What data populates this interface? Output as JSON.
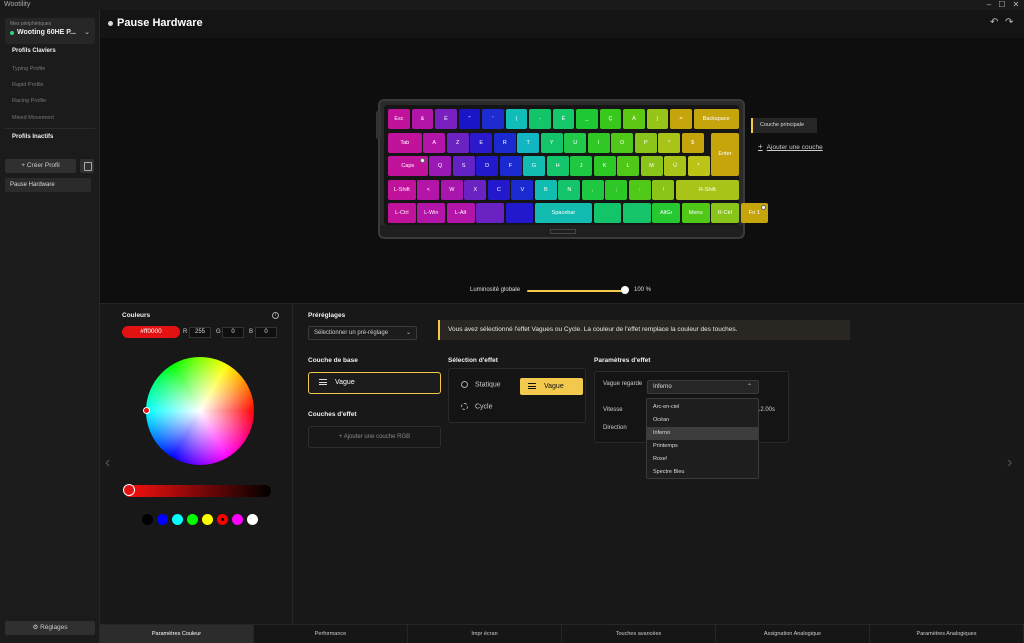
{
  "app": {
    "title": "Wootility"
  },
  "window_controls": {
    "minimize": "–",
    "maximize": "☐",
    "close": "✕"
  },
  "sidebar": {
    "device_label": "Mes périphériques",
    "device_name": "Wooting 60HE P...",
    "keyboard_profiles_heading": "Profils Claviers",
    "keyboard_profiles": [
      "Typing Profile",
      "Rapid Profile",
      "Racing Profile",
      "Mixed Movement"
    ],
    "inactive_profiles_heading": "Profils Inactifs",
    "create_profile": "Créer Profil",
    "inactive_profiles": [
      "Pause Hardware"
    ],
    "settings": "Réglages"
  },
  "header": {
    "title": "Pause Hardware",
    "undo_icon": "↶",
    "redo_icon": "↷"
  },
  "keyboard": {
    "rows": [
      [
        {
          "label": "Esc",
          "color": "#c0129a"
        },
        {
          "label": "&",
          "color": "#b315a8"
        },
        {
          "label": "É",
          "color": "#7a1fc0"
        },
        {
          "label": "\"",
          "color": "#1a16c8"
        },
        {
          "label": "'",
          "color": "#1e2bd0"
        },
        {
          "label": "(",
          "color": "#11bdb8"
        },
        {
          "label": "-",
          "color": "#14c46a"
        },
        {
          "label": "È",
          "color": "#16c86a"
        },
        {
          "label": "_",
          "color": "#1ec832"
        },
        {
          "label": "Ç",
          "color": "#38c81c"
        },
        {
          "label": "À",
          "color": "#5cc814"
        },
        {
          "label": ")",
          "color": "#98c41a"
        },
        {
          "label": "=",
          "color": "#c6a40c"
        },
        {
          "label": "Backspace",
          "color": "#c6a40c"
        }
      ],
      [
        {
          "label": "Tab",
          "color": "#c0129a"
        },
        {
          "label": "A",
          "color": "#b315a8"
        },
        {
          "label": "Z",
          "color": "#6a22c2"
        },
        {
          "label": "E",
          "color": "#2a1acb"
        },
        {
          "label": "R",
          "color": "#1a2ad0"
        },
        {
          "label": "T",
          "color": "#12b6c2"
        },
        {
          "label": "Y",
          "color": "#14c46a"
        },
        {
          "label": "U",
          "color": "#22c84a"
        },
        {
          "label": "I",
          "color": "#30c822"
        },
        {
          "label": "O",
          "color": "#50c818"
        },
        {
          "label": "P",
          "color": "#8ac41a"
        },
        {
          "label": "^",
          "color": "#a8c418"
        },
        {
          "label": "$",
          "color": "#c6a40c"
        }
      ],
      [
        {
          "label": "Caps",
          "color": "#c0129a"
        },
        {
          "label": "Q",
          "color": "#9a18b6"
        },
        {
          "label": "S",
          "color": "#6222c4"
        },
        {
          "label": "D",
          "color": "#2218cc"
        },
        {
          "label": "F",
          "color": "#1a2ad0"
        },
        {
          "label": "G",
          "color": "#12bcb0"
        },
        {
          "label": "H",
          "color": "#14c46a"
        },
        {
          "label": "J",
          "color": "#1ec840"
        },
        {
          "label": "K",
          "color": "#2ec826"
        },
        {
          "label": "L",
          "color": "#50c818"
        },
        {
          "label": "M",
          "color": "#8ac41a"
        },
        {
          "label": "Ù",
          "color": "#a8c418"
        },
        {
          "label": "*",
          "color": "#bcc416"
        },
        {
          "label": "Enter",
          "color": "#c6a40c"
        }
      ],
      [
        {
          "label": "L-Shift",
          "color": "#c0129a"
        },
        {
          "label": "<",
          "color": "#b315a8"
        },
        {
          "label": "W",
          "color": "#a816ae"
        },
        {
          "label": "X",
          "color": "#6a22c2"
        },
        {
          "label": "C",
          "color": "#2418cc"
        },
        {
          "label": "V",
          "color": "#1a2ad0"
        },
        {
          "label": "B",
          "color": "#12bcb0"
        },
        {
          "label": "N",
          "color": "#14c46a"
        },
        {
          "label": ",",
          "color": "#1ec840"
        },
        {
          "label": ";",
          "color": "#2ec826"
        },
        {
          "label": ":",
          "color": "#50c818"
        },
        {
          "label": "!",
          "color": "#8ac41a"
        },
        {
          "label": "R-Shift",
          "color": "#a8c418"
        }
      ],
      [
        {
          "label": "L-Ctrl",
          "color": "#c0129a"
        },
        {
          "label": "L-Win",
          "color": "#b315a8"
        },
        {
          "label": "L-Alt",
          "color": "#b315a8"
        },
        {
          "label": "",
          "color": "#6a22c2"
        },
        {
          "label": "",
          "color": "#2218cc"
        },
        {
          "label": "Spacebar",
          "color": "#12bcb0"
        },
        {
          "label": "",
          "color": "#14c46a"
        },
        {
          "label": "",
          "color": "#16c46a"
        },
        {
          "label": "AltGr",
          "color": "#26c832"
        },
        {
          "label": "Menu",
          "color": "#50c818"
        },
        {
          "label": "R-Ctrl",
          "color": "#8ac41a"
        },
        {
          "label": "Fn 1",
          "color": "#c6a40c"
        }
      ]
    ]
  },
  "layers": {
    "main_layer": "Couche principale",
    "add_layer": "Ajouter une couche"
  },
  "brightness": {
    "label": "Luminosité globale",
    "value": "100 %",
    "fraction": 1.0
  },
  "colors": {
    "title": "Couleurs",
    "hex": "#ff0000",
    "r_label": "R",
    "r": "255",
    "g_label": "G",
    "g": "0",
    "b_label": "B",
    "b": "0",
    "swatches": [
      "#000000",
      "#0000ff",
      "#00ffff",
      "#00ff00",
      "#ffff00",
      "#ff0000",
      "#ff00ff",
      "#ffffff"
    ]
  },
  "presets": {
    "title": "Préréglages",
    "select_placeholder": "Sélectionner un pré-réglage"
  },
  "notice": "Vous avez sélectionné l'effet Vagues ou Cycle. La couleur de l'effet remplace la couleur des touches.",
  "base_layer": {
    "title": "Couche de base",
    "value": "Vague"
  },
  "effect_layers": {
    "title": "Couches d'effet",
    "add": "Ajouter une couche RGB"
  },
  "effect_selection": {
    "title": "Sélection d'effet",
    "static": "Statique",
    "wave": "Vague",
    "cycle": "Cycle"
  },
  "effect_params": {
    "title": "Paramètres d'effet",
    "wave_look_label": "Vague regarde",
    "wave_look_value": "Inferno",
    "speed_label": "Vitesse",
    "speed_value": "12.00s",
    "direction_label": "Direction",
    "options": [
      "Arc-en-ciel",
      "Océan",
      "Inferno",
      "Printemps",
      "Rose!",
      "Spectre Bleu"
    ],
    "selected_option": "Inferno"
  },
  "tabs": [
    "Paramètres Couleur",
    "Performance",
    "Impr écran",
    "Touches avancées",
    "Assignation Analogique",
    "Paramètres Analogiques"
  ],
  "active_tab": "Paramètres Couleur",
  "accent_color": "#f2c94c"
}
